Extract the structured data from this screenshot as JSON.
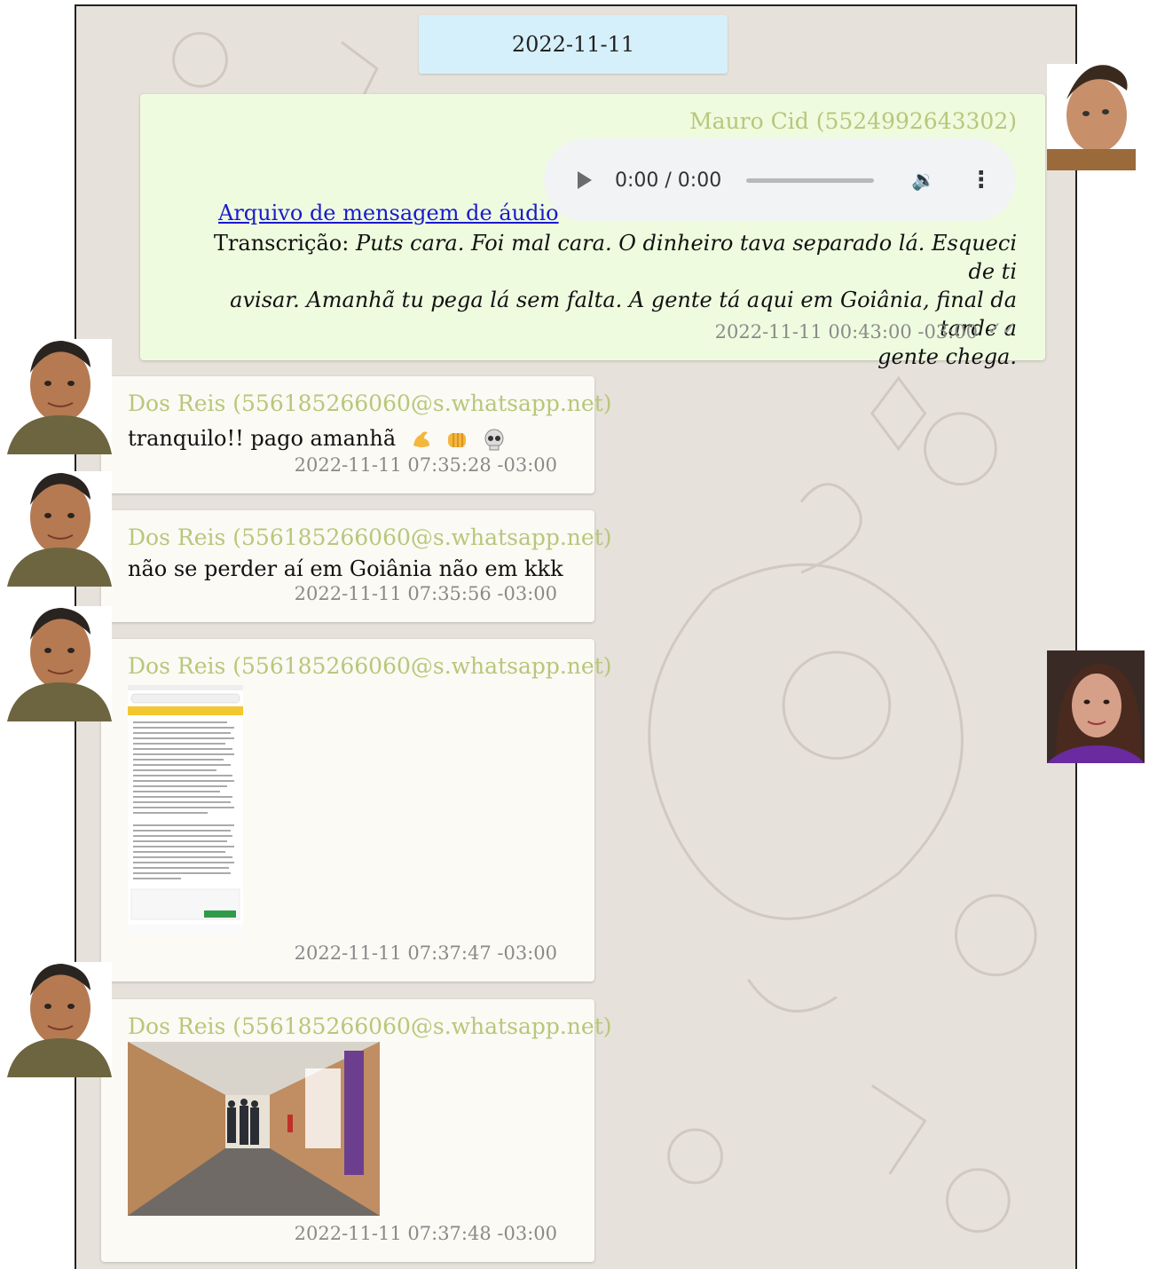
{
  "date_separator": "2022-11-11",
  "colors": {
    "outgoing_bubble": "#eefbdf",
    "incoming_bubble": "#fbfaf5",
    "sender_name": "#b8c77a",
    "date_pill": "#d6f0fb",
    "link": "#1a1acc"
  },
  "messages": [
    {
      "direction": "outgoing",
      "sender": "Mauro Cid (5524992643302)",
      "audio_player": {
        "time": "0:00 / 0:00",
        "progress": 0
      },
      "audio_link": "Arquivo de mensagem de áudio",
      "transcription_label": "Transcrição:",
      "transcription_line1": "Puts cara. Foi mal cara. O dinheiro tava separado lá. Esqueci de ti",
      "transcription_line2": "avisar. Amanhã tu pega lá sem falta. A gente tá aqui em Goiânia, final da tarde a",
      "transcription_line3": "gente chega.",
      "timestamp": "2022-11-11 00:43:00 -03:00",
      "status_icon": "double-check-icon"
    },
    {
      "direction": "incoming",
      "sender": "Dos Reis (556185266060@s.whatsapp.net)",
      "text": "tranquilo!! pago amanhã",
      "emojis": [
        "flexed-biceps-icon",
        "oncoming-fist-icon",
        "skull-icon"
      ],
      "timestamp": "2022-11-11 07:35:28 -03:00"
    },
    {
      "direction": "incoming",
      "sender": "Dos Reis (556185266060@s.whatsapp.net)",
      "text": "não se perder aí em Goiânia não em kkk",
      "timestamp": "2022-11-11 07:35:56 -03:00"
    },
    {
      "direction": "incoming",
      "sender": "Dos Reis (556185266060@s.whatsapp.net)",
      "attachment": "phone-screenshot-image",
      "timestamp": "2022-11-11 07:37:47 -03:00"
    },
    {
      "direction": "incoming",
      "sender": "Dos Reis (556185266060@s.whatsapp.net)",
      "attachment": "corridor-photo-image",
      "timestamp": "2022-11-11 07:37:48 -03:00"
    }
  ]
}
